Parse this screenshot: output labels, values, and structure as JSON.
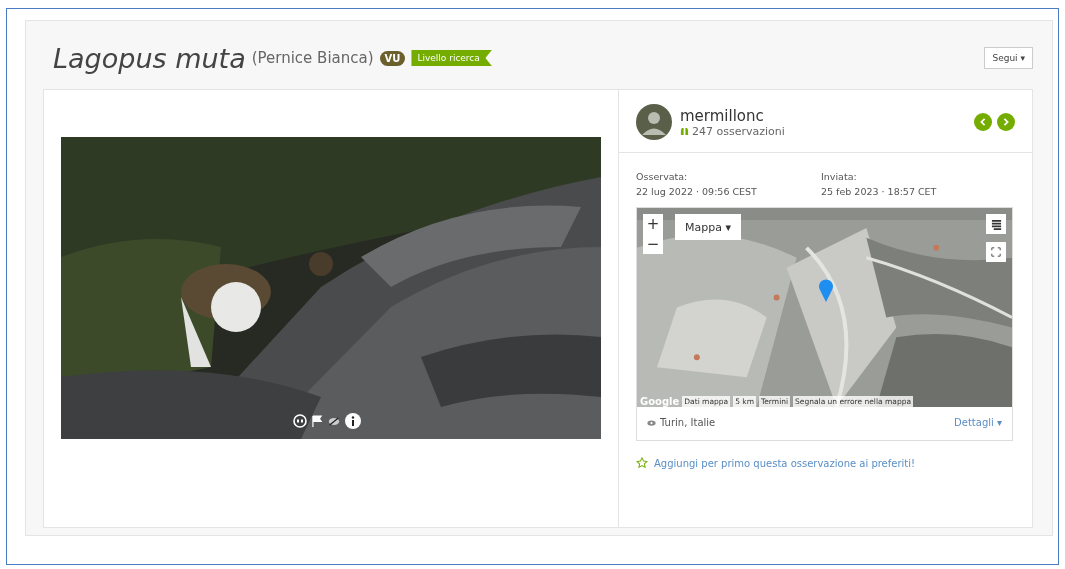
{
  "header": {
    "scientific_name": "Lagopus muta",
    "common_name": "(Pernice Bianca)",
    "status_badge": "VU",
    "quality_badge": "Livello ricerca",
    "follow_button": "Segui ▾"
  },
  "observer": {
    "name": "mermillonc",
    "count": "247 osservazioni"
  },
  "dates": [
    {
      "label": "Osservata:",
      "value": "22 lug 2022 · 09:56 CEST"
    },
    {
      "label": "Inviata:",
      "value": "25 feb 2023 · 18:57 CET"
    }
  ],
  "map": {
    "zoom_in": "+",
    "zoom_out": "−",
    "type_button": "Mappa ▾",
    "attribution": [
      "Google",
      "Dati mappa",
      "5 km",
      "Termini",
      "Segnala un errore nella mappa"
    ]
  },
  "location": {
    "place": "Turin, Italie",
    "details_link": "Dettagli ▾"
  },
  "favorite_link": "Aggiungi per primo questa osservazione ai preferiti!"
}
